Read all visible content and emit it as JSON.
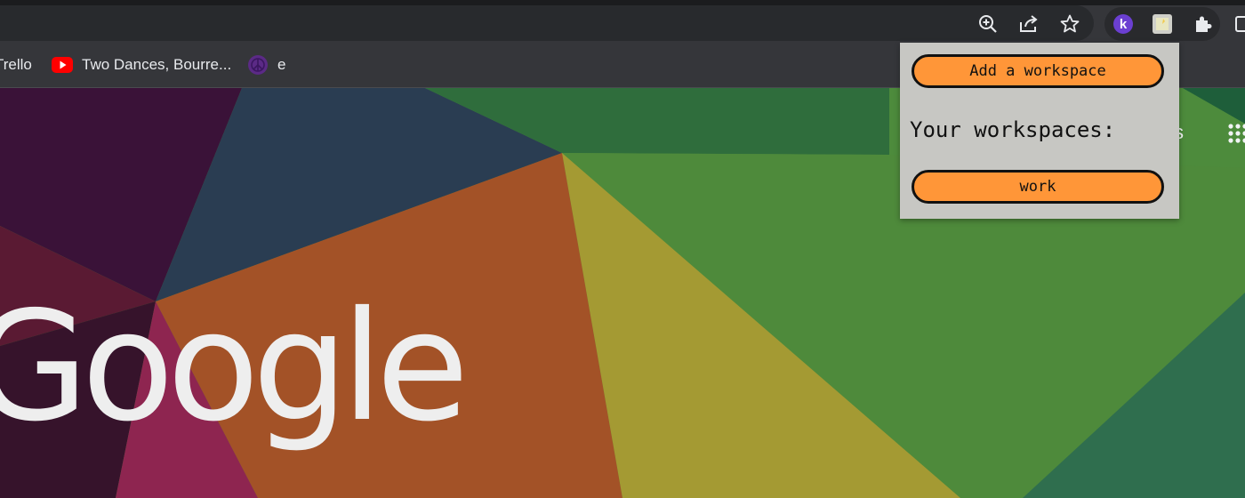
{
  "colors": {
    "accent_orange": "#ff9638",
    "popup_bg": "#c7c7c3",
    "toolbar_bg": "#35363a",
    "omnibox_bg": "#282a2d",
    "kami_purple": "#6b3fd1",
    "youtube_red": "#ff0000"
  },
  "toolbar": {
    "icons": [
      "zoom-icon",
      "share-icon",
      "bookmark-star-icon",
      "kami-extension-icon",
      "workspace-extension-icon",
      "extensions-puzzle-icon",
      "side-panel-icon"
    ],
    "kami_letter": "k"
  },
  "bookmarks": [
    {
      "label": "Trello",
      "icon": "none"
    },
    {
      "label": "Two Dances, Bourre...",
      "icon": "youtube-icon"
    },
    {
      "label": "e",
      "icon": "peace-icon"
    }
  ],
  "new_tab": {
    "logo_text": "Google",
    "partial_link_text": "s"
  },
  "popup": {
    "add_button_label": "Add a workspace",
    "heading": "Your workspaces:",
    "workspaces": [
      "work"
    ]
  }
}
